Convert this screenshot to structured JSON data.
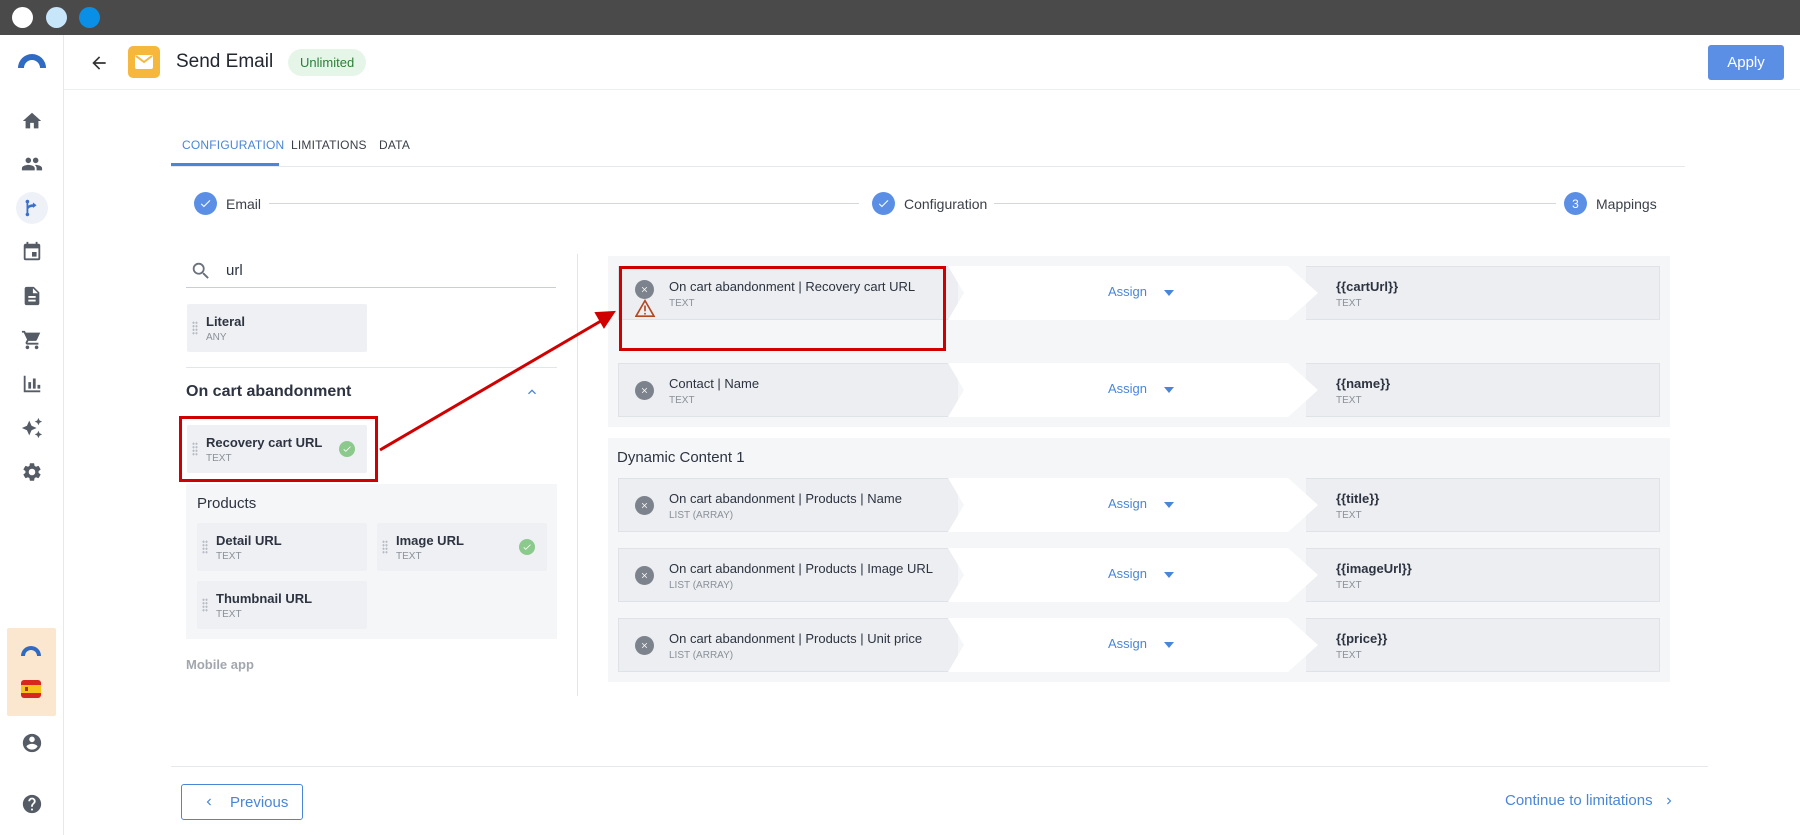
{
  "header": {
    "title": "Send Email",
    "badge": "Unlimited",
    "apply_label": "Apply"
  },
  "tabs": [
    {
      "label": "CONFIGURATION",
      "active": true
    },
    {
      "label": "LIMITATIONS",
      "active": false
    },
    {
      "label": "DATA",
      "active": false
    }
  ],
  "stepper": [
    {
      "label": "Email",
      "state": "done"
    },
    {
      "label": "Configuration",
      "state": "done"
    },
    {
      "label": "Mappings",
      "state": "current",
      "number": "3"
    }
  ],
  "search": {
    "value": "url",
    "placeholder": ""
  },
  "fields": {
    "literal": {
      "name": "Literal",
      "type": "ANY"
    },
    "section_title": "On cart abandonment",
    "recovery": {
      "name": "Recovery cart URL",
      "type": "TEXT"
    },
    "products_title": "Products",
    "detail": {
      "name": "Detail URL",
      "type": "TEXT"
    },
    "image": {
      "name": "Image URL",
      "type": "TEXT"
    },
    "thumbnail": {
      "name": "Thumbnail URL",
      "type": "TEXT"
    },
    "mobile_app": "Mobile app"
  },
  "mappings": [
    {
      "source": "On cart abandonment | Recovery cart URL",
      "source_type": "TEXT",
      "action": "Assign",
      "target": "{{cartUrl}}",
      "target_type": "TEXT",
      "warning": true
    },
    {
      "source": "Contact | Name",
      "source_type": "TEXT",
      "action": "Assign",
      "target": "{{name}}",
      "target_type": "TEXT",
      "warning": false
    }
  ],
  "dynamic_title": "Dynamic Content 1",
  "dynamic_mappings": [
    {
      "source": "On cart abandonment | Products | Name",
      "source_type": "LIST (ARRAY)",
      "action": "Assign",
      "target": "{{title}}",
      "target_type": "TEXT"
    },
    {
      "source": "On cart abandonment | Products | Image URL",
      "source_type": "LIST (ARRAY)",
      "action": "Assign",
      "target": "{{imageUrl}}",
      "target_type": "TEXT"
    },
    {
      "source": "On cart abandonment | Products | Unit price",
      "source_type": "LIST (ARRAY)",
      "action": "Assign",
      "target": "{{price}}",
      "target_type": "TEXT"
    }
  ],
  "footer": {
    "previous_label": "Previous",
    "next_label": "Continue to limitations"
  },
  "colors": {
    "accent": "#5b8fe6",
    "annotation": "#d10000",
    "app_icon": "#f5b83d"
  },
  "icons": [
    "home-icon",
    "users-icon",
    "flow-icon",
    "calendar-icon",
    "document-icon",
    "cart-icon",
    "chart-icon",
    "sparkle-icon",
    "gear-icon",
    "profile-icon",
    "help-icon",
    "search-icon",
    "warning-icon",
    "remove-icon"
  ]
}
